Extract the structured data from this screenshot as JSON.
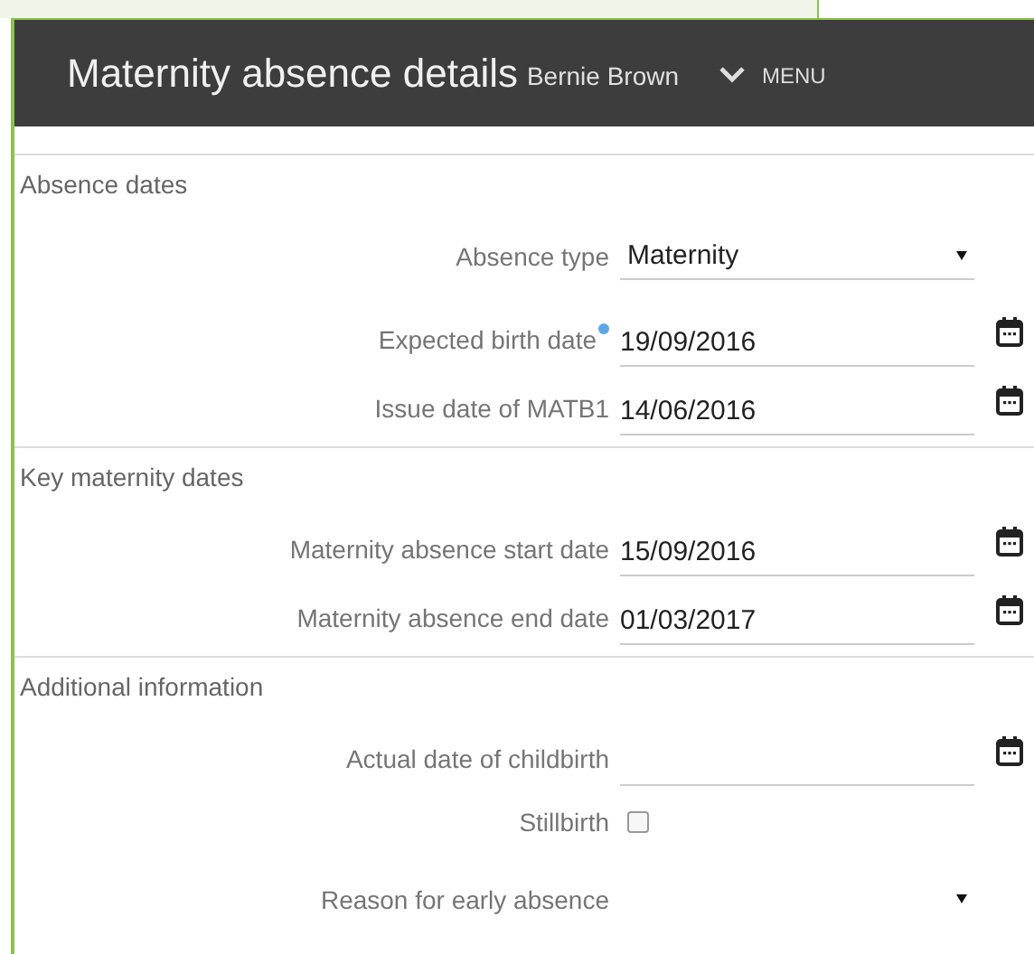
{
  "header": {
    "title": "Maternity absence details",
    "employee": "Bernie Brown",
    "menu": "MENU"
  },
  "sections": [
    {
      "title": "Absence dates",
      "fields": [
        {
          "kind": "select",
          "label": "Absence type",
          "value": "Maternity",
          "required": false
        },
        {
          "kind": "date",
          "label": "Expected birth date",
          "value": "19/09/2016",
          "required": true
        },
        {
          "kind": "date",
          "label": "Issue date of MATB1",
          "value": "14/06/2016",
          "required": false
        }
      ]
    },
    {
      "title": "Key maternity dates",
      "fields": [
        {
          "kind": "date",
          "label": "Maternity absence start date",
          "value": "15/09/2016",
          "required": false
        },
        {
          "kind": "date",
          "label": "Maternity absence end date",
          "value": "01/03/2017",
          "required": false
        }
      ]
    },
    {
      "title": "Additional information",
      "fields": [
        {
          "kind": "date",
          "label": "Actual date of childbirth",
          "required": false
        },
        {
          "kind": "checkbox",
          "label": "Stillbirth",
          "checked": false,
          "required": false
        },
        {
          "kind": "select",
          "label": "Reason for early absence",
          "required": false
        }
      ]
    }
  ]
}
